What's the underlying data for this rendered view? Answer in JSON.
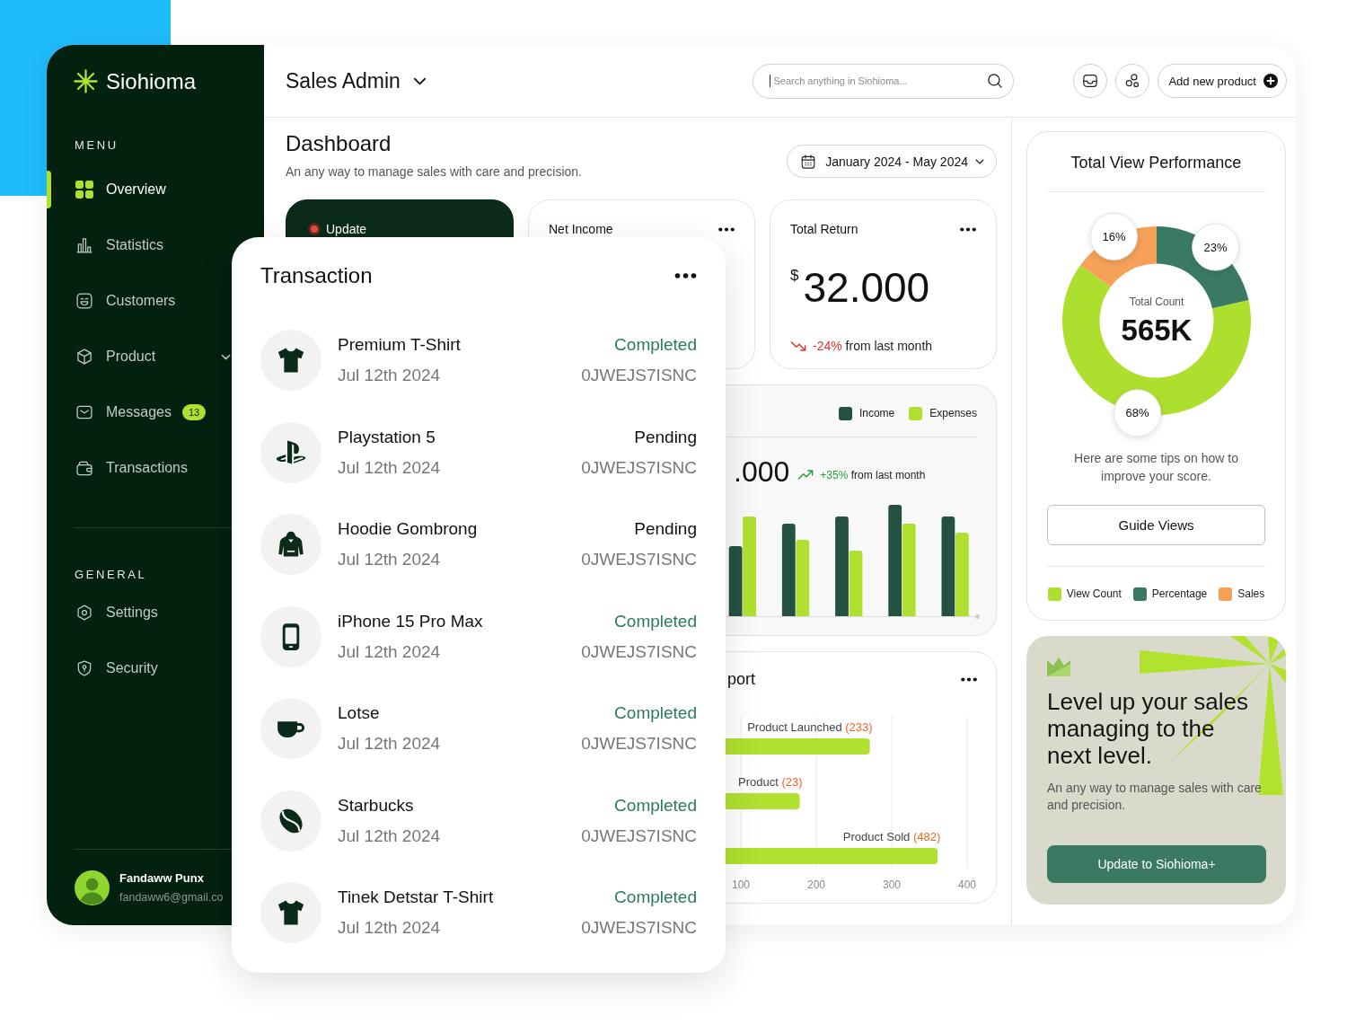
{
  "sidebar": {
    "brand": "Siohioma",
    "menu_title": "MENU",
    "menu": [
      {
        "label": "Overview",
        "expandable": false,
        "selected": true
      },
      {
        "label": "Statistics",
        "expandable": false,
        "selected": false
      },
      {
        "label": "Customers",
        "expandable": false,
        "selected": false
      },
      {
        "label": "Product",
        "expandable": true,
        "selected": false
      },
      {
        "label": "Messages",
        "expandable": false,
        "selected": false,
        "badge": "13"
      },
      {
        "label": "Transactions",
        "expandable": false,
        "selected": false
      }
    ],
    "general_title": "GENERAL",
    "general": [
      {
        "label": "Settings",
        "expandable": false,
        "selected": false
      },
      {
        "label": "Security",
        "expandable": false,
        "selected": false
      }
    ],
    "profile": {
      "name": "Fandaww Punx",
      "email": "fandaww6@gmail.co"
    }
  },
  "header": {
    "workspace": "Sales Admin",
    "search": {
      "placeholder": "Search anything in Siohioma..."
    },
    "add_button": "Add new product"
  },
  "page": {
    "title": "Dashboard",
    "subtitle": "An any way to manage sales with care and precision.",
    "date_range": "January 2024 - May 2024"
  },
  "stat_cards": [
    {
      "kind": "update",
      "label": "Update"
    },
    {
      "kind": "metric",
      "title": "Net Income"
    },
    {
      "kind": "metric",
      "title": "Total Return",
      "currency": "$",
      "value": "32.000",
      "increase": false,
      "change": "-24%",
      "note": "from last month"
    }
  ],
  "income_card": {
    "legend": [
      {
        "label": "Income",
        "color": "#245142"
      },
      {
        "label": "Expenses",
        "color": "#afe030"
      }
    ],
    "value": ".000",
    "increase": true,
    "change": "+35%",
    "note": "from last month"
  },
  "report_card": {
    "title": "port",
    "counts": [
      "(233)",
      "(23)",
      "(482)"
    ],
    "chart_data": {
      "type": "bar",
      "orientation": "horizontal",
      "categories": [
        "Product Launched",
        "Product",
        "Product Sold"
      ],
      "values": [
        271,
        178,
        361
      ],
      "xlim": [
        0,
        400
      ],
      "xticks": [
        100,
        200,
        300,
        400
      ],
      "grid": true
    }
  },
  "performance": {
    "title": "Total View Performance",
    "chart_data": {
      "type": "donut",
      "values": [
        68,
        23,
        16
      ],
      "value_labels": [
        "68%",
        "23%",
        "16%"
      ]
    },
    "center_label": "Total Count",
    "center_value": "565K",
    "tips": "Here are some tips on how to improve your score.",
    "button": "Guide Views",
    "legend": [
      {
        "label": "View Count",
        "color": "#addf2e"
      },
      {
        "label": "Percentage",
        "color": "#3a7a62"
      },
      {
        "label": "Sales",
        "color": "#f6a058"
      }
    ]
  },
  "promo": {
    "heading": "Level up your sales managing to the next level.",
    "text": "An any way to manage sales with care and precision.",
    "button": "Update to Siohioma+"
  },
  "transactions": {
    "title": "Transaction",
    "items": [
      {
        "name": "Premium T-Shirt",
        "date": "Jul 12th 2024",
        "status": "Completed",
        "completed": true,
        "code": "0JWEJS7ISNC"
      },
      {
        "name": "Playstation 5",
        "date": "Jul 12th 2024",
        "status": "Pending",
        "completed": false,
        "code": "0JWEJS7ISNC"
      },
      {
        "name": "Hoodie Gombrong",
        "date": "Jul 12th 2024",
        "status": "Pending",
        "completed": false,
        "code": "0JWEJS7ISNC"
      },
      {
        "name": "iPhone 15 Pro Max",
        "date": "Jul 12th 2024",
        "status": "Completed",
        "completed": true,
        "code": "0JWEJS7ISNC"
      },
      {
        "name": "Lotse",
        "date": "Jul 12th 2024",
        "status": "Completed",
        "completed": true,
        "code": "0JWEJS7ISNC"
      },
      {
        "name": "Starbucks",
        "date": "Jul 12th 2024",
        "status": "Completed",
        "completed": true,
        "code": "0JWEJS7ISNC"
      },
      {
        "name": "Tinek Detstar T-Shirt",
        "date": "Jul 12th 2024",
        "status": "Completed",
        "completed": true,
        "code": "0JWEJS7ISNC"
      }
    ]
  }
}
